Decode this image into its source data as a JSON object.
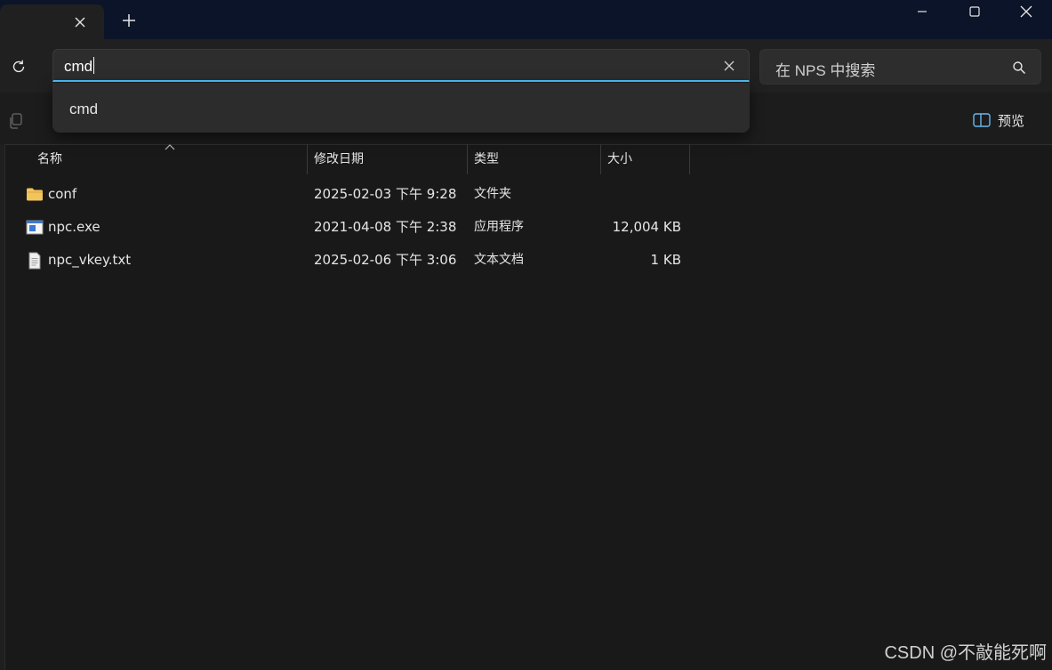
{
  "window": {
    "new_tab_label": "+",
    "controls": [
      "minimize",
      "maximize",
      "close"
    ]
  },
  "address_bar": {
    "value": "cmd",
    "suggestions": [
      {
        "label": "cmd"
      }
    ]
  },
  "search": {
    "placeholder": "在 NPS 中搜索"
  },
  "toolbar": {
    "preview_label": "预览"
  },
  "columns": {
    "name": "名称",
    "modified": "修改日期",
    "type": "类型",
    "size": "大小"
  },
  "files": [
    {
      "name": "conf",
      "modified": "2025-02-03 下午 9:28",
      "type": "文件夹",
      "size": "",
      "icon": "folder-icon"
    },
    {
      "name": "npc.exe",
      "modified": "2021-04-08 下午 2:38",
      "type": "应用程序",
      "size": "12,004 KB",
      "icon": "application-icon"
    },
    {
      "name": "npc_vkey.txt",
      "modified": "2025-02-06 下午 3:06",
      "type": "文本文档",
      "size": "1 KB",
      "icon": "text-file-icon"
    }
  ],
  "watermark": "CSDN @不敲能死啊",
  "colors": {
    "accent": "#4cc2ff",
    "folder": "#f2c55c",
    "background": "#191919",
    "titlebar": "#0b1428"
  }
}
